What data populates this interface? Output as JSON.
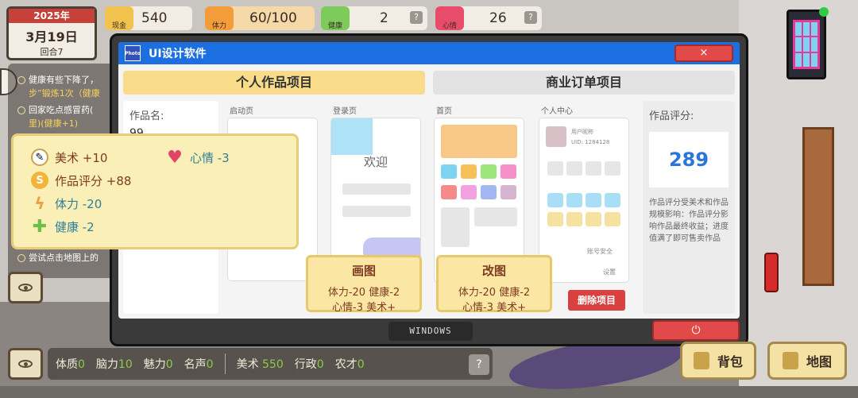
{
  "top": {
    "year": "2025年",
    "date": "3月19日",
    "round": "回合7",
    "money_label": "现金",
    "money": "540",
    "stamina_label": "体力",
    "stamina": "60/100",
    "health_label": "健康",
    "health": "2",
    "mood_label": "心情",
    "mood": "26",
    "help": "?"
  },
  "notifications": [
    {
      "text": "健康有些下降了，",
      "extra": "步”锻炼1次（健康"
    },
    {
      "text": "回家吃点感冒药(",
      "extra": "里)(健康+1)"
    },
    {
      "text": "尝试点击地图上的"
    }
  ],
  "reward": {
    "art": "美术 +10",
    "mood": "心情 -3",
    "score": "作品评分 +88",
    "stamina": "体力 -20",
    "health": "健康 -2"
  },
  "window": {
    "title": "UI设计软件",
    "app_logo": "Photo",
    "close": "×",
    "tab_personal": "个人作品项目",
    "tab_business": "商业订单项目",
    "name_label": "作品名:",
    "name_value": "99",
    "pages": [
      "启动页",
      "登录页",
      "首页",
      "个人中心"
    ],
    "welcome": "欢迎",
    "user_nick": "用户昵称",
    "user_uid": "UID: 1284128",
    "account_security": "账号安全",
    "settings": "设置",
    "score_label": "作品评分:",
    "score_value": "289",
    "score_desc": "作品评分受美术和作品规模影响：作品评分影响作品最终收益；进度值满了即可售卖作品",
    "draw_title": "画图",
    "draw_cost1": "体力-20 健康-2",
    "draw_cost2": "心情-3 美术+",
    "edit_title": "改图",
    "edit_cost1": "体力-20 健康-2",
    "edit_cost2": "心情-3 美术+",
    "delete": "删除项目",
    "taskbar": "WINDOWS",
    "power": "⏻"
  },
  "bottom": {
    "physique_label": "体质",
    "physique": "0",
    "brain_label": "脑力",
    "brain": "10",
    "charm_label": "魅力",
    "charm": "0",
    "fame_label": "名声",
    "fame": "0",
    "art_label": "美术",
    "art": "550",
    "admin_label": "行政",
    "admin": "0",
    "farm_label": "农才",
    "farm": "0",
    "help": "?",
    "bag": "背包",
    "map": "地图"
  }
}
